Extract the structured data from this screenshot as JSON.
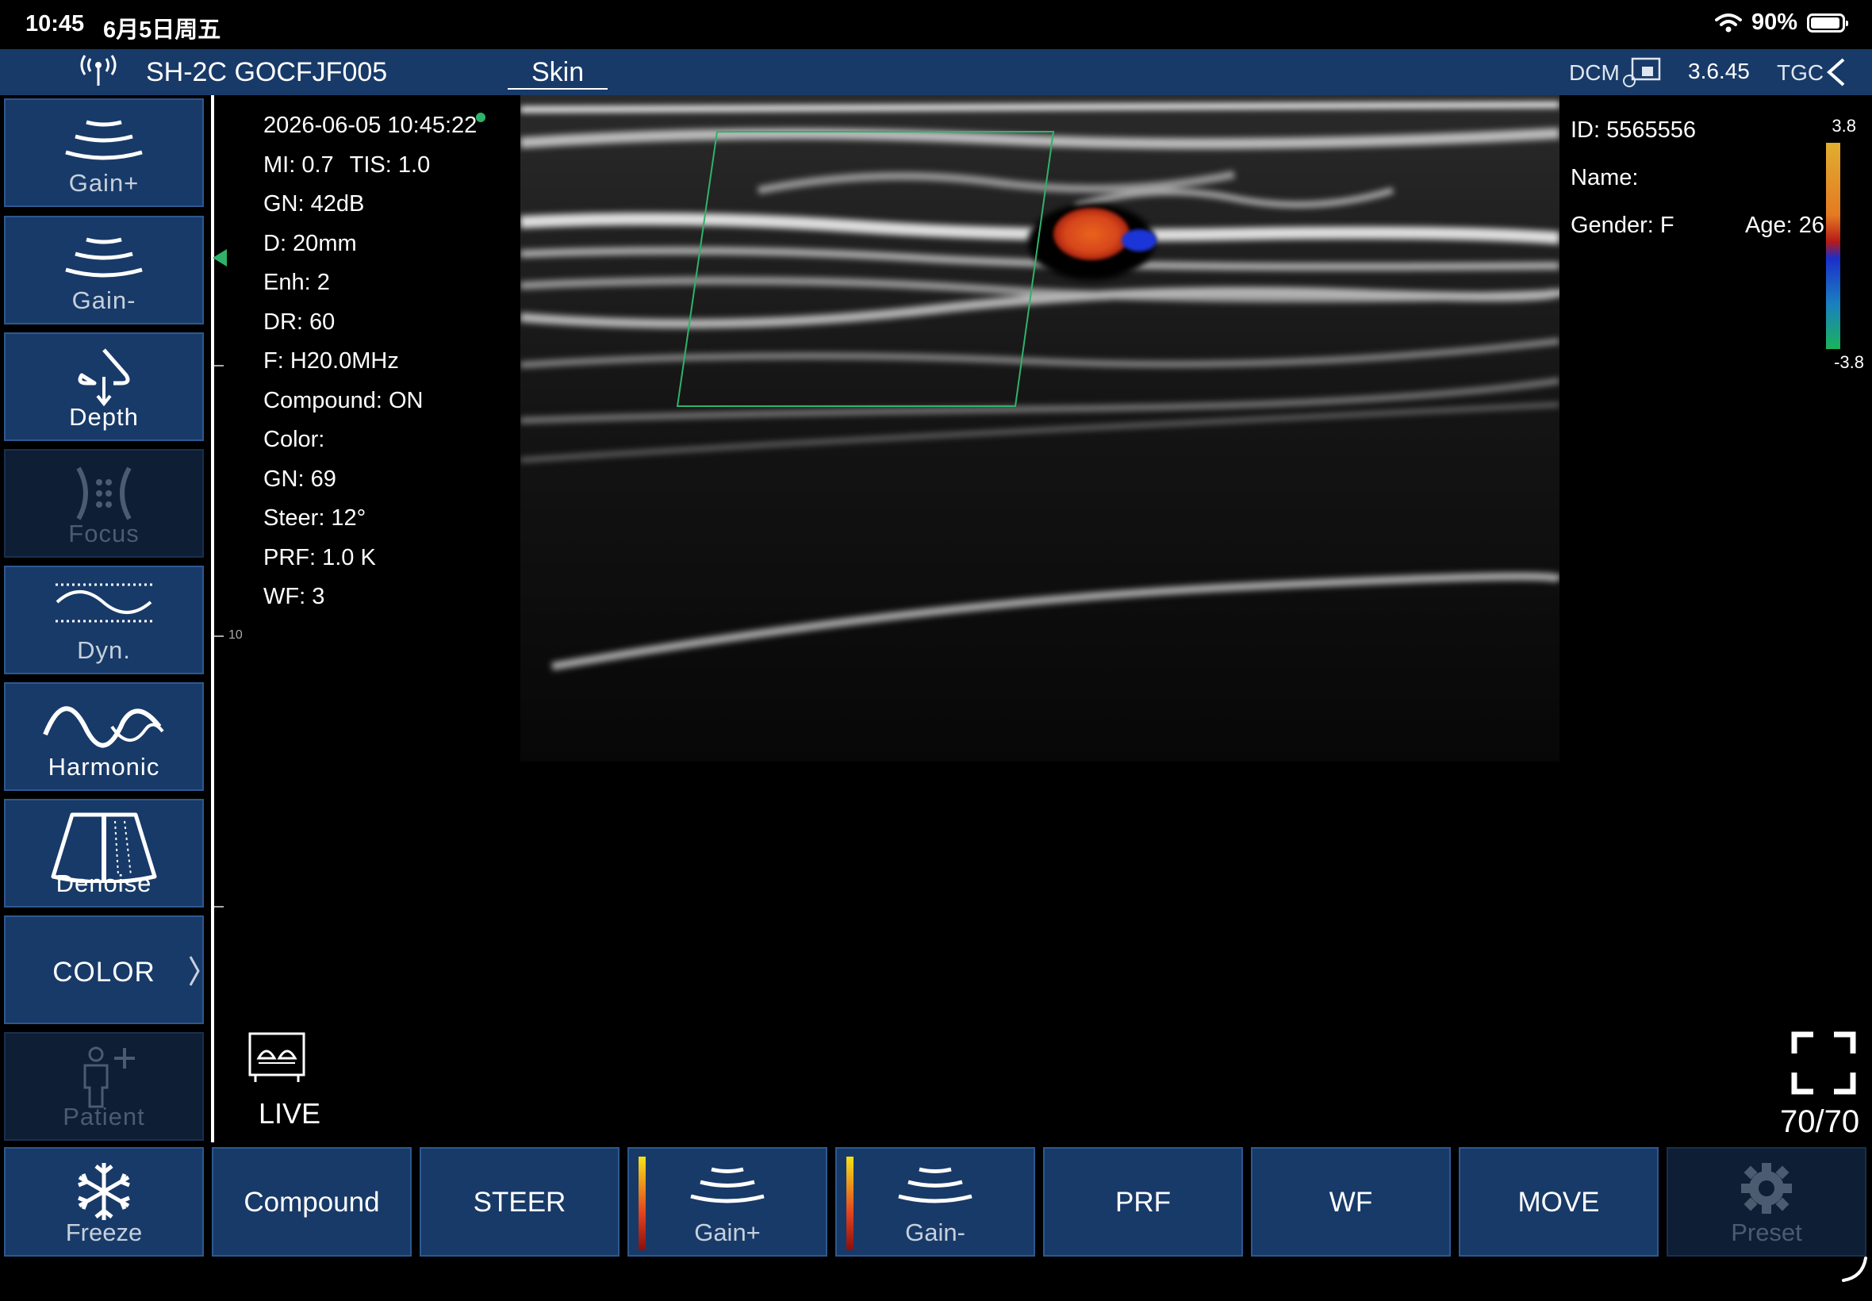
{
  "status": {
    "time": "10:45",
    "date": "6月5日周五",
    "battery": "90%",
    "battery_level": 0.9
  },
  "header": {
    "device": "SH-2C GOCFJF005",
    "preset": "Skin",
    "dcm": "DCM",
    "version": "3.6.45",
    "tgc": "TGC"
  },
  "left_buttons": [
    {
      "label": "Gain+",
      "icon": "gain-up-icon",
      "enabled": true
    },
    {
      "label": "Gain-",
      "icon": "gain-down-icon",
      "enabled": true
    },
    {
      "label": "Depth",
      "icon": "depth-icon",
      "enabled": true
    },
    {
      "label": "Focus",
      "icon": "focus-icon",
      "enabled": false
    },
    {
      "label": "Dyn.",
      "icon": "dynamic-range-icon",
      "enabled": true
    },
    {
      "label": "Harmonic",
      "icon": "harmonic-icon",
      "enabled": true
    },
    {
      "label": "Denoise",
      "icon": "denoise-icon",
      "enabled": true
    },
    {
      "label": "COLOR",
      "icon": "chevron-right-icon",
      "enabled": true
    },
    {
      "label": "Patient",
      "icon": "patient-add-icon",
      "enabled": false
    }
  ],
  "ruler": {
    "tick_label": "10"
  },
  "image_params": {
    "datetime": "2026-06-05 10:45:22",
    "mi": "MI: 0.7",
    "tis": "TIS: 1.0",
    "gn": "GN: 42dB",
    "d": "D: 20mm",
    "enh": "Enh: 2",
    "dr": "DR: 60",
    "f": "F: H20.0MHz",
    "compound": "Compound: ON",
    "color": "Color:",
    "color_gn": "GN: 69",
    "steer": "Steer: 12°",
    "prf": "PRF: 1.0 K",
    "wf": "WF: 3"
  },
  "patient": {
    "id": "ID: 5565556",
    "name": "Name:",
    "gender": "Gender: F",
    "age": "Age: 26"
  },
  "color_scale": {
    "max": "3.8",
    "min": "-3.8",
    "colors": [
      "#e1ae30",
      "#b51a18",
      "#1b2ec9",
      "#19b45a"
    ]
  },
  "live": {
    "label": "LIVE",
    "icon": "probe-display-icon"
  },
  "frames": "70/70",
  "bottom_buttons": [
    {
      "label": "Freeze",
      "icon": "snowflake-icon",
      "enabled": true
    },
    {
      "label": "Compound",
      "enabled": true
    },
    {
      "label": "STEER",
      "enabled": true
    },
    {
      "label": "Gain+",
      "icon": "gain-up-icon",
      "enabled": true
    },
    {
      "label": "Gain-",
      "icon": "gain-down-icon",
      "enabled": true
    },
    {
      "label": "PRF",
      "enabled": true
    },
    {
      "label": "WF",
      "enabled": true
    },
    {
      "label": "MOVE",
      "enabled": true
    },
    {
      "label": "Preset",
      "icon": "gear-icon",
      "enabled": false
    }
  ],
  "colors": {
    "panel": "#183a68",
    "border": "#2d5890",
    "roi": "#2fb36a",
    "text": "#ffffff"
  }
}
